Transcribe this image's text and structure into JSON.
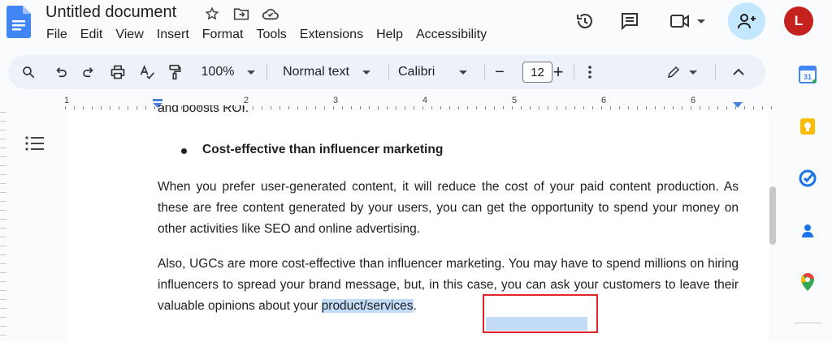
{
  "header": {
    "title": "Untitled document",
    "menu": [
      "File",
      "Edit",
      "View",
      "Insert",
      "Format",
      "Tools",
      "Extensions",
      "Help",
      "Accessibility"
    ],
    "avatar_initial": "L",
    "icons": [
      "star-icon",
      "move-folder-icon",
      "cloud-status-icon",
      "history-icon",
      "comments-icon",
      "meet-icon",
      "share-icon"
    ]
  },
  "toolbar": {
    "zoom": "100%",
    "style": "Normal text",
    "font": "Calibri",
    "font_size": "12",
    "minus": "−",
    "plus": "+"
  },
  "ruler": {
    "numbers": [
      "1",
      "1",
      "2",
      "3",
      "4",
      "5",
      "6"
    ]
  },
  "document": {
    "partial_line": "and boosts ROI.",
    "bullet": "Cost-effective than influencer marketing",
    "para1": "When you prefer user-generated content, it will reduce the cost of your paid content production. As these are free content generated by your users, you can get the opportunity to spend your money on other activities like SEO and online advertising.",
    "para2_start": "Also, UGCs are more cost-effective than influencer marketing. You may have to spend millions on hiring influencers to spread your brand message, but, in this case, you can ask your customers to leave their valuable opinions about your ",
    "para2_selected": "product/services",
    "para2_end": "."
  },
  "side_panel": {
    "icons": [
      "calendar-icon",
      "keep-icon",
      "tasks-icon",
      "contacts-icon",
      "maps-icon"
    ],
    "calendar_day": "31"
  },
  "colors": {
    "selection": "#c2dcf8",
    "highlight_box": "#e0242b",
    "share_bg": "#c2e7ff",
    "avatar_bg": "#c5221f",
    "toolbar_bg": "#edf2fa"
  }
}
